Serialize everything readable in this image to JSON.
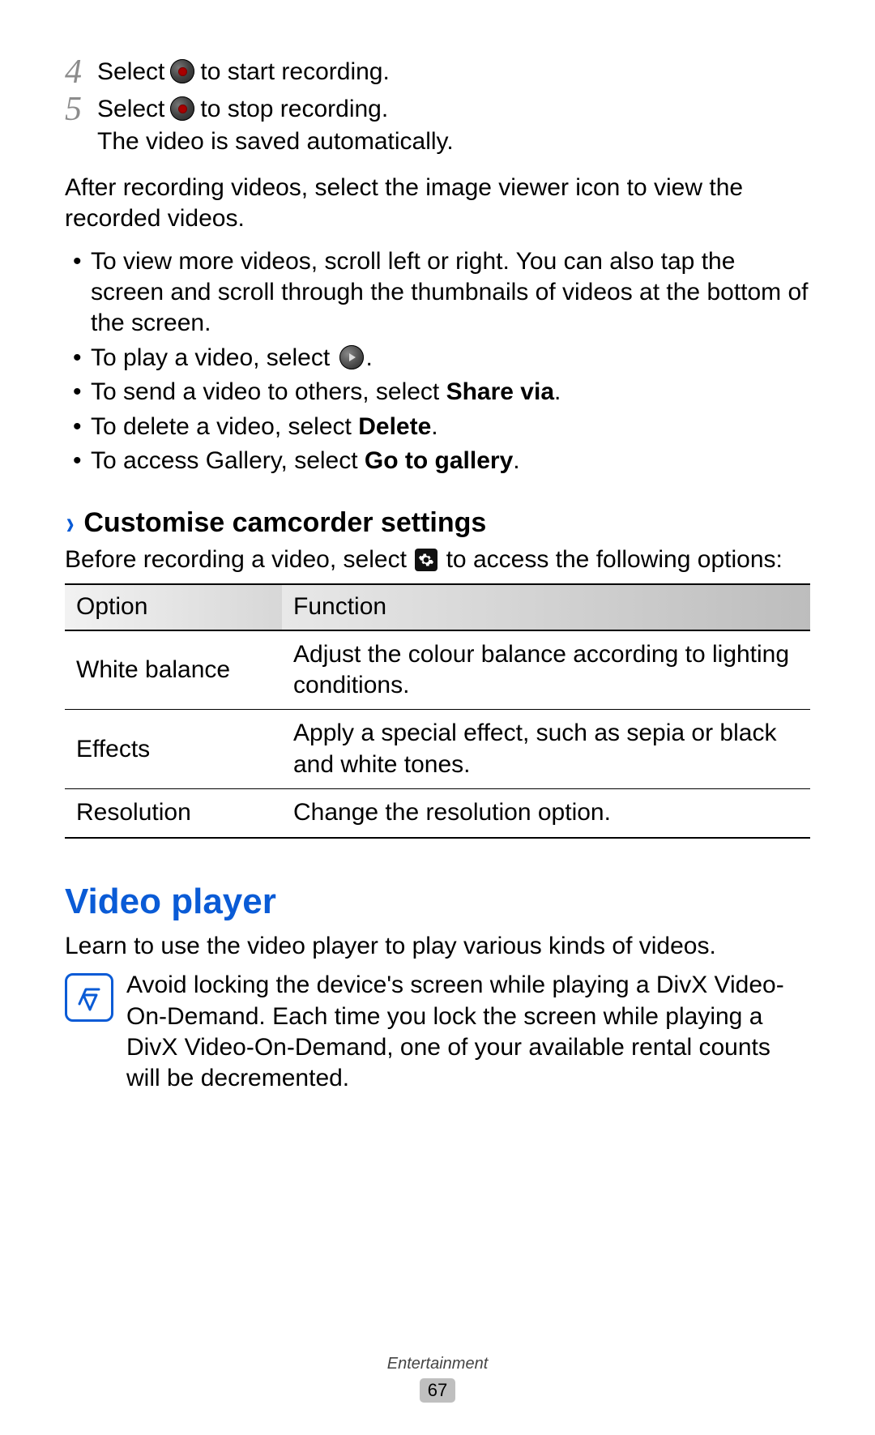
{
  "steps": {
    "s4_num": "4",
    "s4_pre": "Select",
    "s4_post": "to start recording.",
    "s5_num": "5",
    "s5_pre": "Select",
    "s5_post": "to stop recording.",
    "s5_sub": "The video is saved automatically."
  },
  "after_para": "After recording videos, select the image viewer icon to view the recorded videos.",
  "bullets": {
    "b1": "To view more videos, scroll left or right. You can also tap the screen and scroll through the thumbnails of videos at the bottom of the screen.",
    "b2_pre": "To play a video, select",
    "b2_post": ".",
    "b3_pre": "To send a video to others, select ",
    "b3_bold": "Share via",
    "b3_post": ".",
    "b4_pre": "To delete a video, select ",
    "b4_bold": "Delete",
    "b4_post": ".",
    "b5_pre": "To access Gallery, select ",
    "b5_bold": "Go to gallery",
    "b5_post": "."
  },
  "customise": {
    "heading": "Customise camcorder settings",
    "intro_pre": "Before recording a video, select",
    "intro_post": "to access the following options:"
  },
  "table": {
    "h1": "Option",
    "h2": "Function",
    "rows": [
      {
        "opt": "White balance",
        "fn": "Adjust the colour balance according to lighting conditions."
      },
      {
        "opt": "Effects",
        "fn": "Apply a special effect, such as sepia or black and white tones."
      },
      {
        "opt": "Resolution",
        "fn": "Change the resolution option."
      }
    ]
  },
  "video_player": {
    "heading": "Video player",
    "intro": "Learn to use the video player to play various kinds of videos.",
    "note": "Avoid locking the device's screen while playing a DivX Video-On-Demand. Each time you lock the screen while playing a DivX Video-On-Demand, one of your available rental counts will be decremented."
  },
  "footer": {
    "category": "Entertainment",
    "page": "67"
  }
}
